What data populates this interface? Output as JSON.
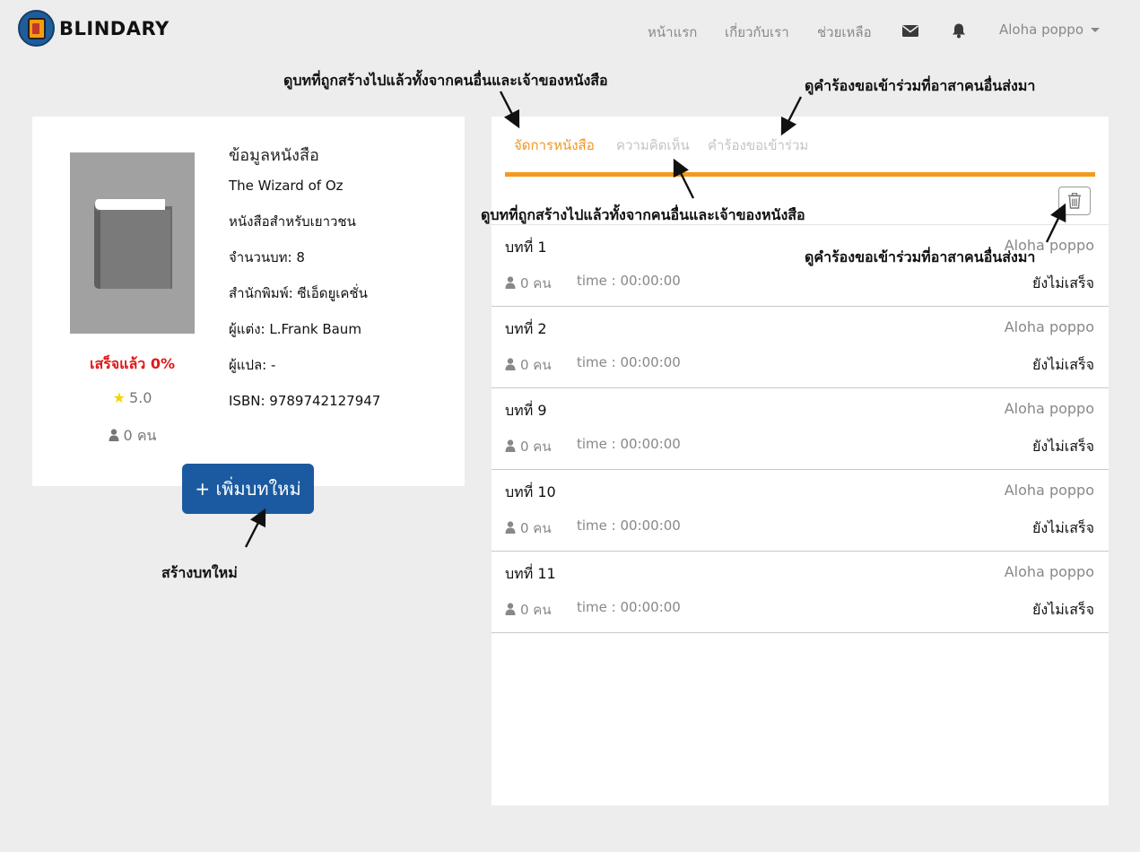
{
  "brand": {
    "name": "BLINDARY"
  },
  "nav": {
    "home": "หน้าแรก",
    "about": "เกี่ยวกับเรา",
    "help": "ช่วยเหลือ",
    "user": "Aloha poppo"
  },
  "book": {
    "heading": "ข้อมูลหนังสือ",
    "title": "The Wizard of Oz",
    "category": "หนังสือสำหรับเยาวชน",
    "chapters": "จำนวนบท: 8",
    "publisher": "สำนักพิมพ์: ซีเอ็ดยูเคชั่น",
    "author": "ผู้แต่ง: L.Frank Baum",
    "translator": "ผู้แปล: -",
    "isbn": "ISBN: 9789742127947",
    "progress": "เสร็จแล้ว 0%",
    "rating": "5.0",
    "readers": "0 คน",
    "add_button": "+ เพิ่มบทใหม่"
  },
  "tabs": {
    "manage": "จัดการหนังสือ",
    "comments": "ความคิดเห็น",
    "requests": "คำร้องขอเข้าร่วม"
  },
  "chapters": [
    {
      "title": "บทที่ 1",
      "owner": "Aloha poppo",
      "readers": "0 คน",
      "time": "time : 00:00:00",
      "status": "ยังไม่เสร็จ"
    },
    {
      "title": "บทที่ 2",
      "owner": "Aloha poppo",
      "readers": "0 คน",
      "time": "time : 00:00:00",
      "status": "ยังไม่เสร็จ"
    },
    {
      "title": "บทที่ 9",
      "owner": "Aloha poppo",
      "readers": "0 คน",
      "time": "time : 00:00:00",
      "status": "ยังไม่เสร็จ"
    },
    {
      "title": "บทที่ 10",
      "owner": "Aloha poppo",
      "readers": "0 คน",
      "time": "time : 00:00:00",
      "status": "ยังไม่เสร็จ"
    },
    {
      "title": "บทที่ 11",
      "owner": "Aloha poppo",
      "readers": "0 คน",
      "time": "time : 00:00:00",
      "status": "ยังไม่เสร็จ"
    }
  ],
  "annotations": {
    "manage_tab": "ดูบทที่ถูกสร้างไปแล้วทั้งจากคนอื่นและเจ้าของหนังสือ",
    "requests_tab": "ดูคำร้องขอเข้าร่วมที่อาสาคนอื่นส่งมา",
    "comments_tab": "ดูบทที่ถูกสร้างไปแล้วทั้งจากคนอื่นและเจ้าของหนังสือ",
    "trash": "ดูคำร้องขอเข้าร่วมที่อาสาคนอื่นส่งมา",
    "add_chapter": "สร้างบทใหม่"
  },
  "colors": {
    "accent": "#f0961c",
    "primary_button": "#1b5aa0",
    "progress": "#e01818",
    "star": "#f5d400",
    "page_bg": "#ededed"
  }
}
